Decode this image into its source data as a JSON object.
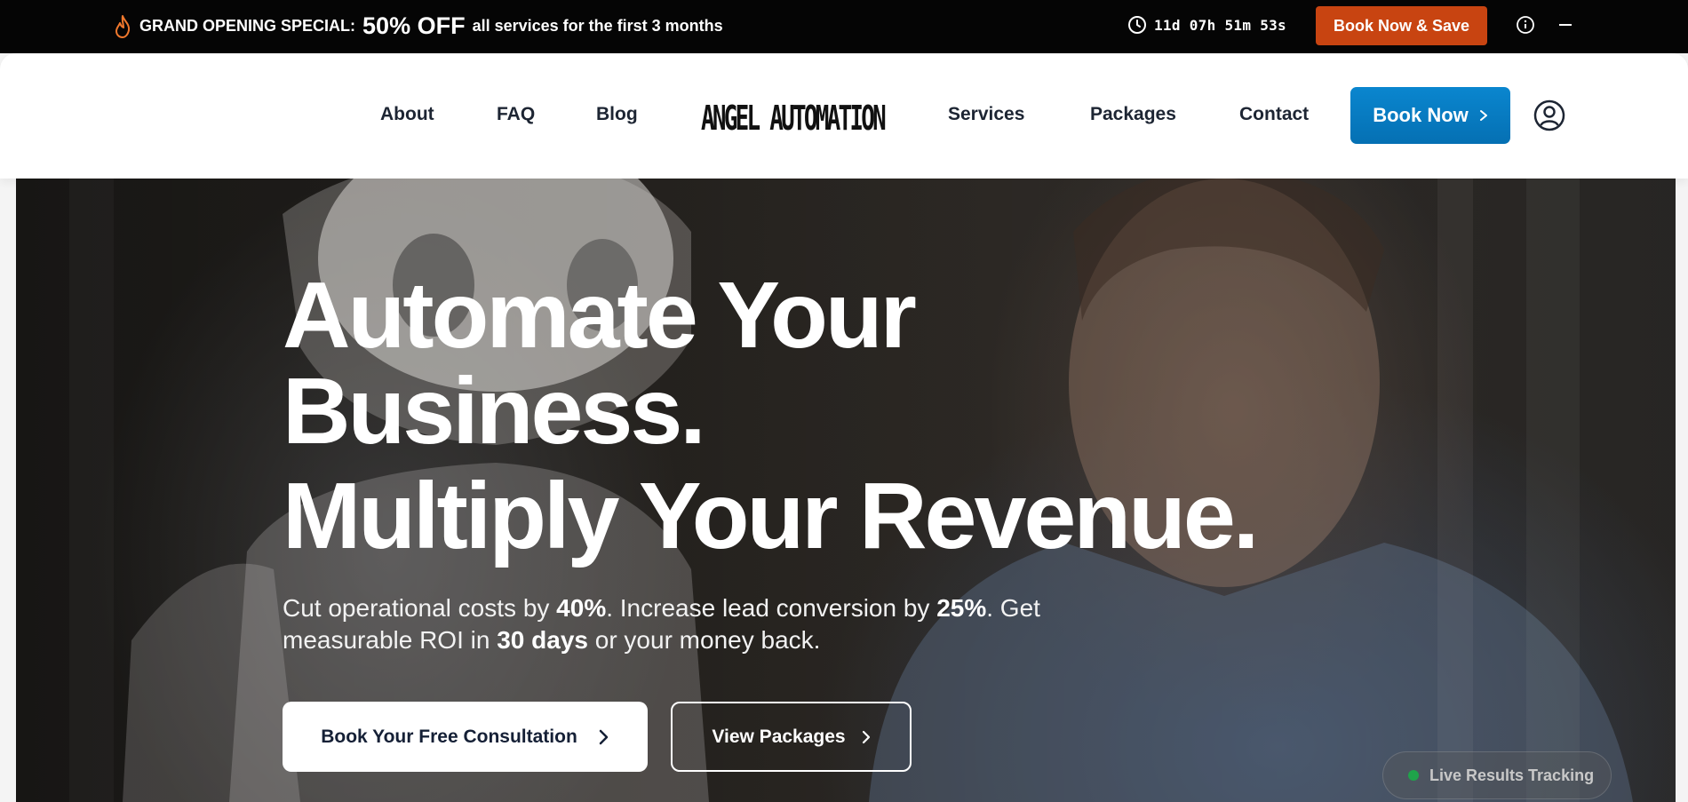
{
  "promo": {
    "label": "GRAND OPENING SPECIAL:",
    "discount": "50% OFF",
    "description": "all services for the first 3 months",
    "countdown": "11d 07h 51m 53s",
    "cta": "Book Now & Save",
    "icons": [
      "flame-icon",
      "clock-icon",
      "info-icon",
      "minimize-icon"
    ]
  },
  "header": {
    "nav_left": [
      "About",
      "FAQ",
      "Blog"
    ],
    "logo_text": "ANGEL AUTOMATION",
    "nav_right": [
      "Services",
      "Packages",
      "Contact"
    ],
    "book_label": "Book Now"
  },
  "hero": {
    "headline_line1": "Automate Your",
    "headline_line2": "Business.",
    "headline_line3": "Multiply Your Revenue.",
    "sub_part1": "Cut operational costs by ",
    "sub_bold1": "40%",
    "sub_part2": ". Increase lead conversion by ",
    "sub_bold2": "25%",
    "sub_part3": ". Get measurable ROI in ",
    "sub_bold3": "30 days",
    "sub_part4": " or your money back.",
    "primary_cta": "Book Your Free Consultation",
    "secondary_cta": "View Packages",
    "live_badge": "Live Results Tracking"
  },
  "colors": {
    "promo_bg": "#050505",
    "promo_cta": "#c84411",
    "nav_cta": "#0a7fc4",
    "live_dot": "#1fa34a"
  }
}
